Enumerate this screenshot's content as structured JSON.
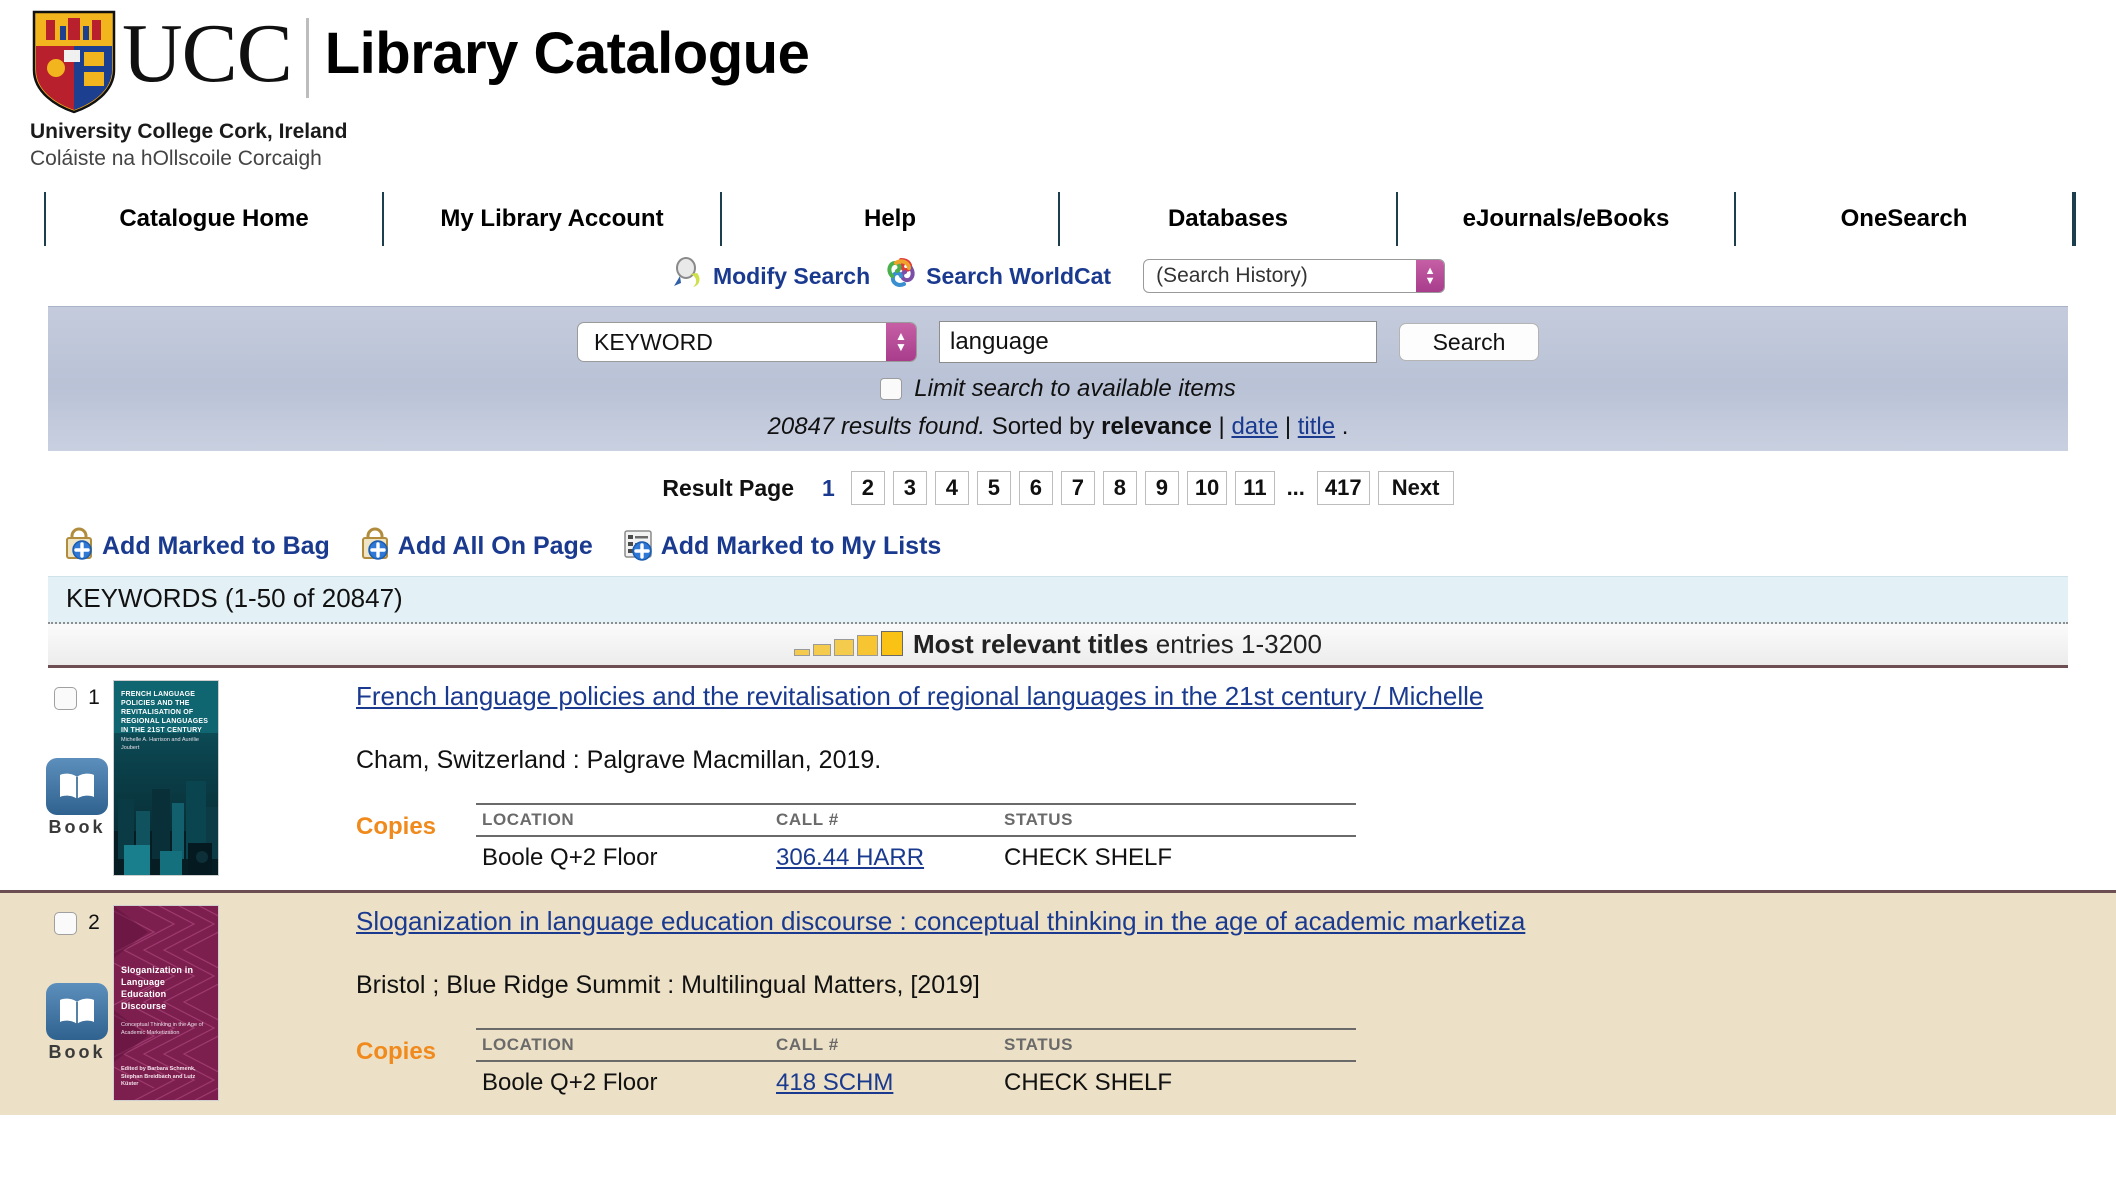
{
  "brand": {
    "acronym": "UCC",
    "site_title": "Library Catalogue",
    "university_en": "University College Cork, Ireland",
    "university_ga": "Coláiste na hOllscoile Corcaigh"
  },
  "nav": {
    "items": [
      {
        "label": "Catalogue Home"
      },
      {
        "label": "My Library Account"
      },
      {
        "label": "Help"
      },
      {
        "label": "Databases"
      },
      {
        "label": "eJournals/eBooks"
      },
      {
        "label": "OneSearch"
      }
    ]
  },
  "toolbar": {
    "modify_search": "Modify Search",
    "search_worldcat": "Search WorldCat",
    "search_history_value": "(Search History)"
  },
  "search": {
    "index_value": "KEYWORD",
    "query_value": "language",
    "query_placeholder": "",
    "button_label": "Search",
    "limit_label": "Limit search to available items",
    "limit_checked": false,
    "results_count_text": "20847 results found.",
    "sorted_by_text": "Sorted by",
    "sort_active": "relevance",
    "sort_date": "date",
    "sort_title": "title",
    "sep": "|",
    "period": "."
  },
  "pagination": {
    "label": "Result Page",
    "current": "1",
    "pages": [
      "2",
      "3",
      "4",
      "5",
      "6",
      "7",
      "8",
      "9",
      "10",
      "11"
    ],
    "ellipsis": "...",
    "last": "417",
    "next": "Next"
  },
  "actions": [
    {
      "label": "Add Marked to Bag",
      "icon": "bag-plus-icon"
    },
    {
      "label": "Add All On Page",
      "icon": "bag-plus-icon"
    },
    {
      "label": "Add Marked to My Lists",
      "icon": "list-plus-icon"
    }
  ],
  "keywords_band": "KEYWORDS (1-50 of 20847)",
  "relevance_band": {
    "strong_text": "Most relevant titles",
    "entries_text": "entries 1-3200",
    "bars": 5
  },
  "columns": {
    "location": "LOCATION",
    "call": "CALL #",
    "status": "STATUS",
    "copies": "Copies"
  },
  "results": [
    {
      "num": "1",
      "media_label": "Book",
      "media_icon": "open-book-icon",
      "title": "French language policies and the revitalisation of regional languages in the 21st century / Michelle",
      "imprint": "Cham, Switzerland : Palgrave Macmillan, 2019.",
      "cover_title": "FRENCH LANGUAGE POLICIES AND THE REVITALISATION OF REGIONAL LANGUAGES IN THE 21ST CENTURY",
      "cover_sub": "Michelle A. Harrison and Aurélie Joubert",
      "copies": [
        {
          "location": "Boole Q+2 Floor",
          "call": "306.44 HARR",
          "status": "CHECK SHELF"
        }
      ]
    },
    {
      "num": "2",
      "media_label": "Book",
      "media_icon": "open-book-icon",
      "title": "Sloganization in language education discourse : conceptual thinking in the age of academic marketiza",
      "imprint": "Bristol ; Blue Ridge Summit : Multilingual Matters, [2019]",
      "cover_title": "Sloganization in Language Education Discourse",
      "cover_sub": "Conceptual Thinking in the Age of Academic Marketization",
      "cover_authors": "Edited by Barbara Schmenk, Stephan Breidbach and Lutz Küster",
      "copies": [
        {
          "location": "Boole Q+2 Floor",
          "call": "418 SCHM",
          "status": "CHECK SHELF"
        }
      ]
    }
  ],
  "colors": {
    "link": "#1a3a8f",
    "accent_orange": "#f08a1c",
    "panel": "#c0c8da",
    "alt_row": "#ece0c6",
    "keywords_band": "#e3f1f7",
    "relevance_gold": "#f5cb4e"
  }
}
